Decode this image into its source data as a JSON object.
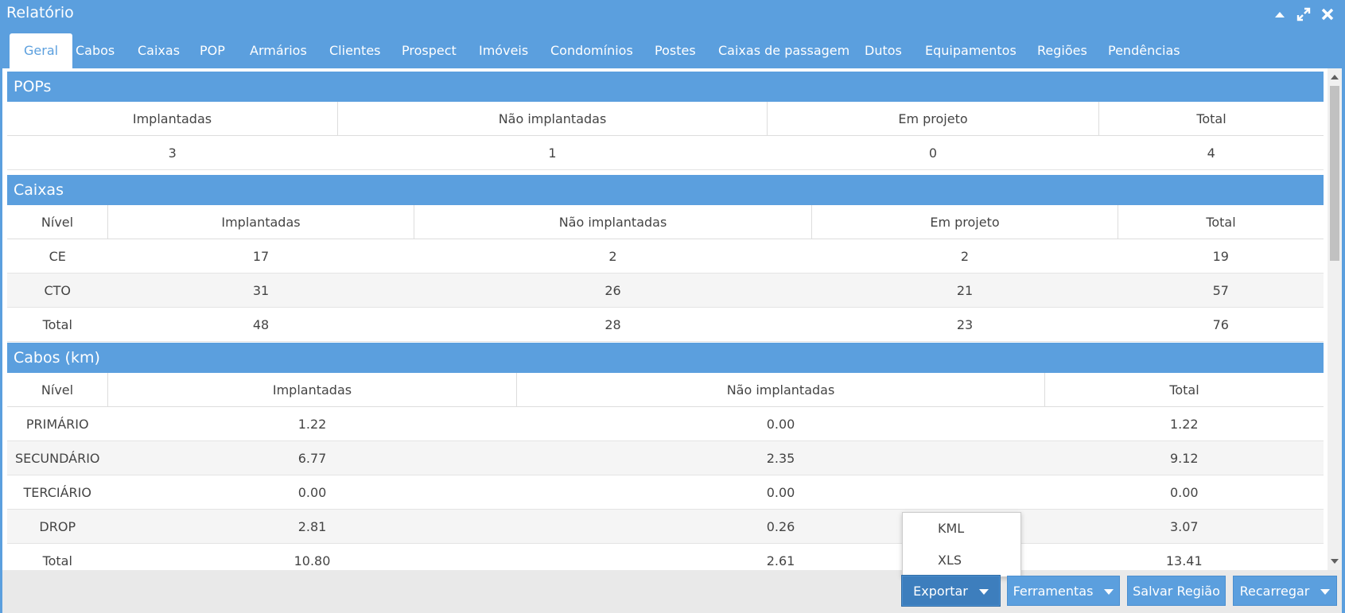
{
  "window": {
    "title": "Relatório",
    "icons": [
      "collapse-icon",
      "expand-icon",
      "close-icon"
    ]
  },
  "tabs": [
    {
      "label": "Geral"
    },
    {
      "label": "Cabos"
    },
    {
      "label": "Caixas"
    },
    {
      "label": "POP"
    },
    {
      "label": "Armários"
    },
    {
      "label": "Clientes"
    },
    {
      "label": "Prospect"
    },
    {
      "label": "Imóveis"
    },
    {
      "label": "Condomínios"
    },
    {
      "label": "Postes"
    },
    {
      "label": "Caixas de passagem"
    },
    {
      "label": "Dutos"
    },
    {
      "label": "Equipamentos"
    },
    {
      "label": "Regiões"
    },
    {
      "label": "Pendências"
    }
  ],
  "active_tab": "Geral",
  "pops": {
    "title": "POPs",
    "headers": [
      "Implantadas",
      "Não implantadas",
      "Em projeto",
      "Total"
    ],
    "row": [
      "3",
      "1",
      "0",
      "4"
    ]
  },
  "caixas": {
    "title": "Caixas",
    "headers": [
      "Nível",
      "Implantadas",
      "Não implantadas",
      "Em projeto",
      "Total"
    ],
    "rows": [
      [
        "CE",
        "17",
        "2",
        "2",
        "19"
      ],
      [
        "CTO",
        "31",
        "26",
        "21",
        "57"
      ],
      [
        "Total",
        "48",
        "28",
        "23",
        "76"
      ]
    ]
  },
  "cabos": {
    "title": "Cabos (km)",
    "headers": [
      "Nível",
      "Implantadas",
      "Não implantadas",
      "Total"
    ],
    "rows": [
      [
        "PRIMÁRIO",
        "1.22",
        "0.00",
        "1.22"
      ],
      [
        "SECUNDÁRIO",
        "6.77",
        "2.35",
        "9.12"
      ],
      [
        "TERCIÁRIO",
        "0.00",
        "0.00",
        "0.00"
      ],
      [
        "DROP",
        "2.81",
        "0.26",
        "3.07"
      ],
      [
        "Total",
        "10.80",
        "2.61",
        "13.41"
      ]
    ]
  },
  "export_menu": {
    "items": [
      "KML",
      "XLS"
    ]
  },
  "footer": {
    "exportar": "Exportar",
    "ferramentas": "Ferramentas",
    "salvar": "Salvar Região",
    "recarregar": "Recarregar"
  },
  "colors": {
    "accent": "#5b9fde",
    "accent_dark": "#3d7ebd",
    "footer_bg": "#e9e9e9",
    "alt_row": "#f5f5f5"
  }
}
